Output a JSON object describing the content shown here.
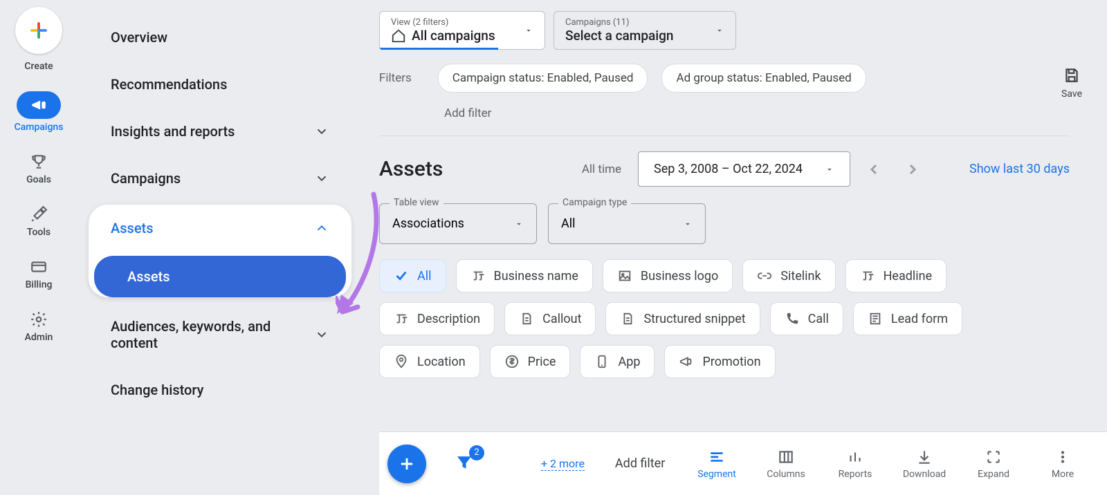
{
  "rail": {
    "create": "Create",
    "items": [
      {
        "label": "Campaigns",
        "icon": "megaphone",
        "active": true
      },
      {
        "label": "Goals",
        "icon": "trophy",
        "active": false
      },
      {
        "label": "Tools",
        "icon": "tools",
        "active": false
      },
      {
        "label": "Billing",
        "icon": "card",
        "active": false
      },
      {
        "label": "Admin",
        "icon": "gear",
        "active": false
      }
    ]
  },
  "sidebar": {
    "items": [
      {
        "label": "Overview"
      },
      {
        "label": "Recommendations"
      },
      {
        "label": "Insights and reports",
        "chevron": true
      },
      {
        "label": "Campaigns",
        "chevron": true
      }
    ],
    "assets": {
      "label": "Assets",
      "sub": "Assets"
    },
    "tail": [
      {
        "label": "Audiences, keywords, and content",
        "chevron": true
      },
      {
        "label": "Change history"
      }
    ]
  },
  "top": {
    "view": {
      "small": "View (2 filters)",
      "main": "All campaigns"
    },
    "campaign": {
      "small": "Campaigns (11)",
      "main": "Select a campaign"
    }
  },
  "filters": {
    "label": "Filters",
    "chips": [
      "Campaign status: Enabled, Paused",
      "Ad group status: Enabled, Paused"
    ],
    "add": "Add filter"
  },
  "save": "Save",
  "header": {
    "title": "Assets",
    "alltime": "All time",
    "date_range": "Sep 3, 2008 – Oct 22, 2024",
    "show30": "Show last 30 days"
  },
  "selectors": {
    "table_view": {
      "legend": "Table view",
      "value": "Associations"
    },
    "campaign_type": {
      "legend": "Campaign type",
      "value": "All"
    }
  },
  "asset_types": [
    {
      "label": "All",
      "active": true,
      "icon": "check"
    },
    {
      "label": "Business name",
      "icon": "text"
    },
    {
      "label": "Business logo",
      "icon": "image"
    },
    {
      "label": "Sitelink",
      "icon": "link"
    },
    {
      "label": "Headline",
      "icon": "text"
    },
    {
      "label": "Description",
      "icon": "text"
    },
    {
      "label": "Callout",
      "icon": "doc"
    },
    {
      "label": "Structured snippet",
      "icon": "doc"
    },
    {
      "label": "Call",
      "icon": "phone"
    },
    {
      "label": "Lead form",
      "icon": "form"
    },
    {
      "label": "Location",
      "icon": "pin"
    },
    {
      "label": "Price",
      "icon": "price"
    },
    {
      "label": "App",
      "icon": "app"
    },
    {
      "label": "Promotion",
      "icon": "promo"
    }
  ],
  "toolbar": {
    "filter_badge": "2",
    "more": "+ 2 more",
    "add_filter": "Add filter",
    "items": [
      {
        "label": "Segment",
        "active": true
      },
      {
        "label": "Columns"
      },
      {
        "label": "Reports"
      },
      {
        "label": "Download"
      },
      {
        "label": "Expand"
      },
      {
        "label": "More"
      }
    ]
  }
}
